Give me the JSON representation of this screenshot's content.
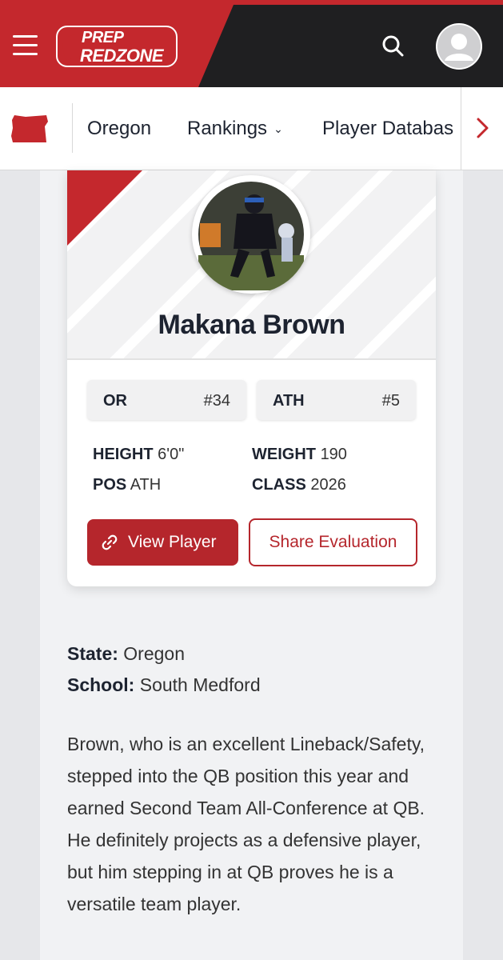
{
  "header": {
    "logo_line1": "PREP",
    "logo_line2": "REDZONE",
    "accent_color": "#c4282d"
  },
  "subnav": {
    "state_icon": "oregon-state-shape-icon",
    "items": [
      "Oregon",
      "Rankings",
      "Player Databas"
    ],
    "dropdown_icon": "chevron-down-icon",
    "scroll_icon": "chevron-right-icon"
  },
  "player": {
    "name": "Makana Brown",
    "state_rank": {
      "label": "OR",
      "value": "#34"
    },
    "position_rank": {
      "label": "ATH",
      "value": "#5"
    },
    "attributes": {
      "height": {
        "label": "HEIGHT",
        "value": "6'0\""
      },
      "weight": {
        "label": "WEIGHT",
        "value": "190"
      },
      "pos": {
        "label": "POS",
        "value": "ATH"
      },
      "class": {
        "label": "CLASS",
        "value": "2026"
      }
    },
    "view_button": "View Player",
    "share_button": "Share Evaluation"
  },
  "details": {
    "state_label": "State:",
    "state_value": "Oregon",
    "school_label": "School:",
    "school_value": "South Medford",
    "bio": "Brown, who is an excellent Lineback/Safety, stepped into the QB position this year and earned Second Team All-Conference at QB. He definitely projects as a defensive player, but him stepping in at QB proves he is a versatile team player."
  }
}
